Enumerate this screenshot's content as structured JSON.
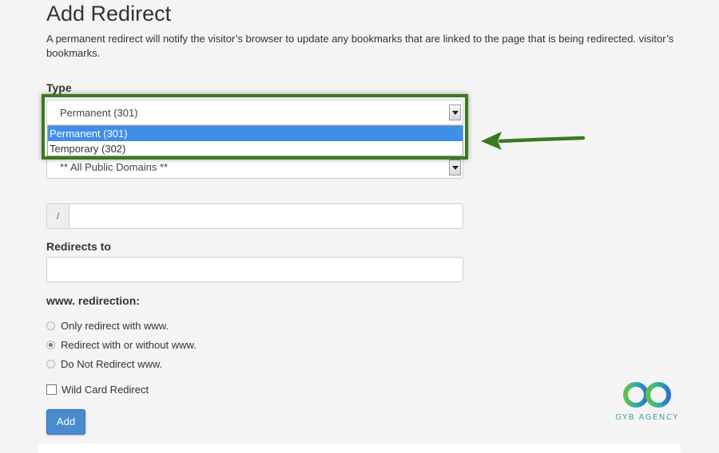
{
  "page": {
    "title": "Add Redirect",
    "description": "A permanent redirect will notify the visitor’s browser to update any bookmarks that are linked to the page that is being redirected. visitor’s bookmarks."
  },
  "type_field": {
    "label": "Type",
    "selected": "Permanent (301)",
    "options": [
      "Permanent (301)",
      "Temporary (302)"
    ]
  },
  "domain_field": {
    "selected": "** All Public Domains **"
  },
  "path_field": {
    "prefix": "/",
    "value": ""
  },
  "redirects_to": {
    "label": "Redirects to",
    "value": ""
  },
  "www_redirection": {
    "label": "www. redirection:",
    "options": [
      "Only redirect with www.",
      "Redirect with or without www.",
      "Do Not Redirect www."
    ],
    "selected_index": 1
  },
  "wildcard": {
    "label": "Wild Card Redirect",
    "checked": false
  },
  "add_button": {
    "label": "Add"
  },
  "logo": {
    "text": "GYB AGENCY"
  },
  "colors": {
    "highlight": "#3a7a1f",
    "selected_option": "#3f8ee8",
    "button": "#4a8bd0",
    "logo": "#3aa8a5"
  }
}
